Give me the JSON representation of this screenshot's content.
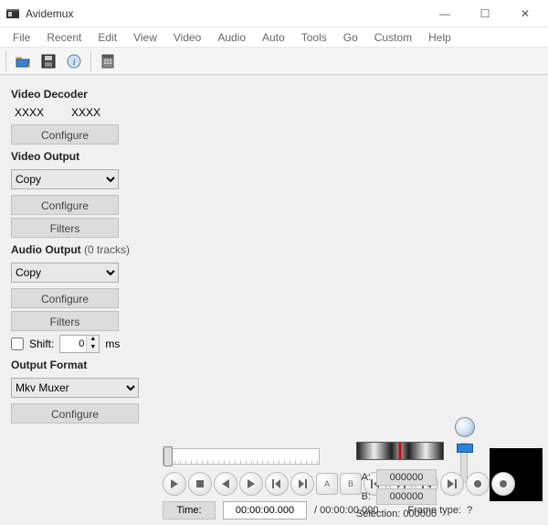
{
  "titlebar": {
    "app": "Avidemux"
  },
  "menu": {
    "file": "File",
    "recent": "Recent",
    "edit": "Edit",
    "view": "View",
    "video": "Video",
    "audio": "Audio",
    "auto": "Auto",
    "tools": "Tools",
    "go": "Go",
    "custom": "Custom",
    "help": "Help"
  },
  "decoder": {
    "head": "Video Decoder",
    "val1": "XXXX",
    "val2": "XXXX",
    "configure": "Configure"
  },
  "voutput": {
    "head": "Video Output",
    "selected": "Copy",
    "configure": "Configure",
    "filters": "Filters"
  },
  "aoutput": {
    "head": "Audio Output",
    "sub": "(0 tracks)",
    "selected": "Copy",
    "configure": "Configure",
    "filters": "Filters",
    "shift_label": "Shift:",
    "shift_value": "0",
    "shift_unit": "ms"
  },
  "oformat": {
    "head": "Output Format",
    "selected": "Mkv Muxer",
    "configure": "Configure"
  },
  "transport": {
    "time_label": "Time:",
    "time_value": "00:00:00.000",
    "duration_prefix": "/ ",
    "duration": "00:00:00.000",
    "frametype_label": "Frame type:",
    "frametype_value": "?"
  },
  "marks": {
    "a_label": "A:",
    "a_value": "000000",
    "b_label": "B:",
    "b_value": "000000",
    "selection_label": "Selection:",
    "selection_value": "000000"
  }
}
